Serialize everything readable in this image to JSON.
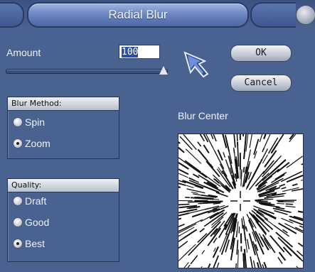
{
  "window": {
    "title": "Radial Blur"
  },
  "amount": {
    "label": "Amount",
    "value": "100",
    "slider_fraction": 1.0
  },
  "buttons": {
    "ok": "OK",
    "cancel": "Cancel"
  },
  "blur_method": {
    "header": "Blur Method:",
    "options": [
      {
        "label": "Spin",
        "checked": false
      },
      {
        "label": "Zoom",
        "checked": true
      }
    ]
  },
  "quality": {
    "header": "Quality:",
    "options": [
      {
        "label": "Draft",
        "checked": false
      },
      {
        "label": "Good",
        "checked": false
      },
      {
        "label": "Best",
        "checked": true
      }
    ]
  },
  "blur_center": {
    "label": "Blur Center"
  },
  "colors": {
    "background": "#4a6290",
    "title_bar": "#6d88c2",
    "input_selection": "#2d4fa0"
  }
}
